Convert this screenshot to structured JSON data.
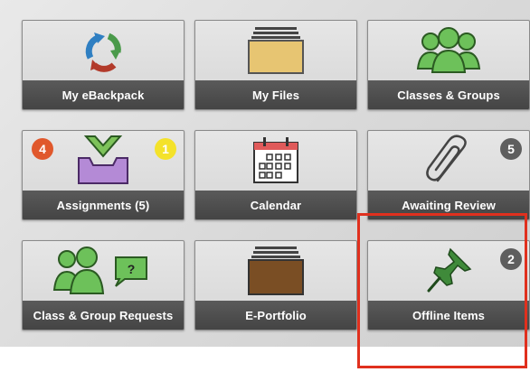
{
  "tiles": [
    {
      "label": "My eBackpack",
      "icon": "ebackpack-recycle-icon"
    },
    {
      "label": "My Files",
      "icon": "folder-stack-icon"
    },
    {
      "label": "Classes & Groups",
      "icon": "group-people-icon"
    },
    {
      "label": "Assignments (5)",
      "icon": "inbox-tray-icon",
      "badge_left": "4",
      "badge_right": "1"
    },
    {
      "label": "Calendar",
      "icon": "calendar-icon"
    },
    {
      "label": "Awaiting Review",
      "icon": "paperclip-icon",
      "badge": "5"
    },
    {
      "label": "Class & Group Requests",
      "icon": "group-question-icon"
    },
    {
      "label": "E-Portfolio",
      "icon": "portfolio-folder-icon"
    },
    {
      "label": "Offline Items",
      "icon": "pushpin-icon",
      "badge": "2"
    }
  ],
  "colors": {
    "badge_orange": "#e0582c",
    "badge_yellow": "#f4e22a",
    "badge_gray": "#5e5e5e",
    "highlight": "#e0301e",
    "people_green": "#6dc15a",
    "folder_tan": "#e7c572",
    "portfolio_brown": "#7a4e24",
    "inbox_purple": "#b48ad6",
    "pin_green": "#3f8a3a"
  }
}
